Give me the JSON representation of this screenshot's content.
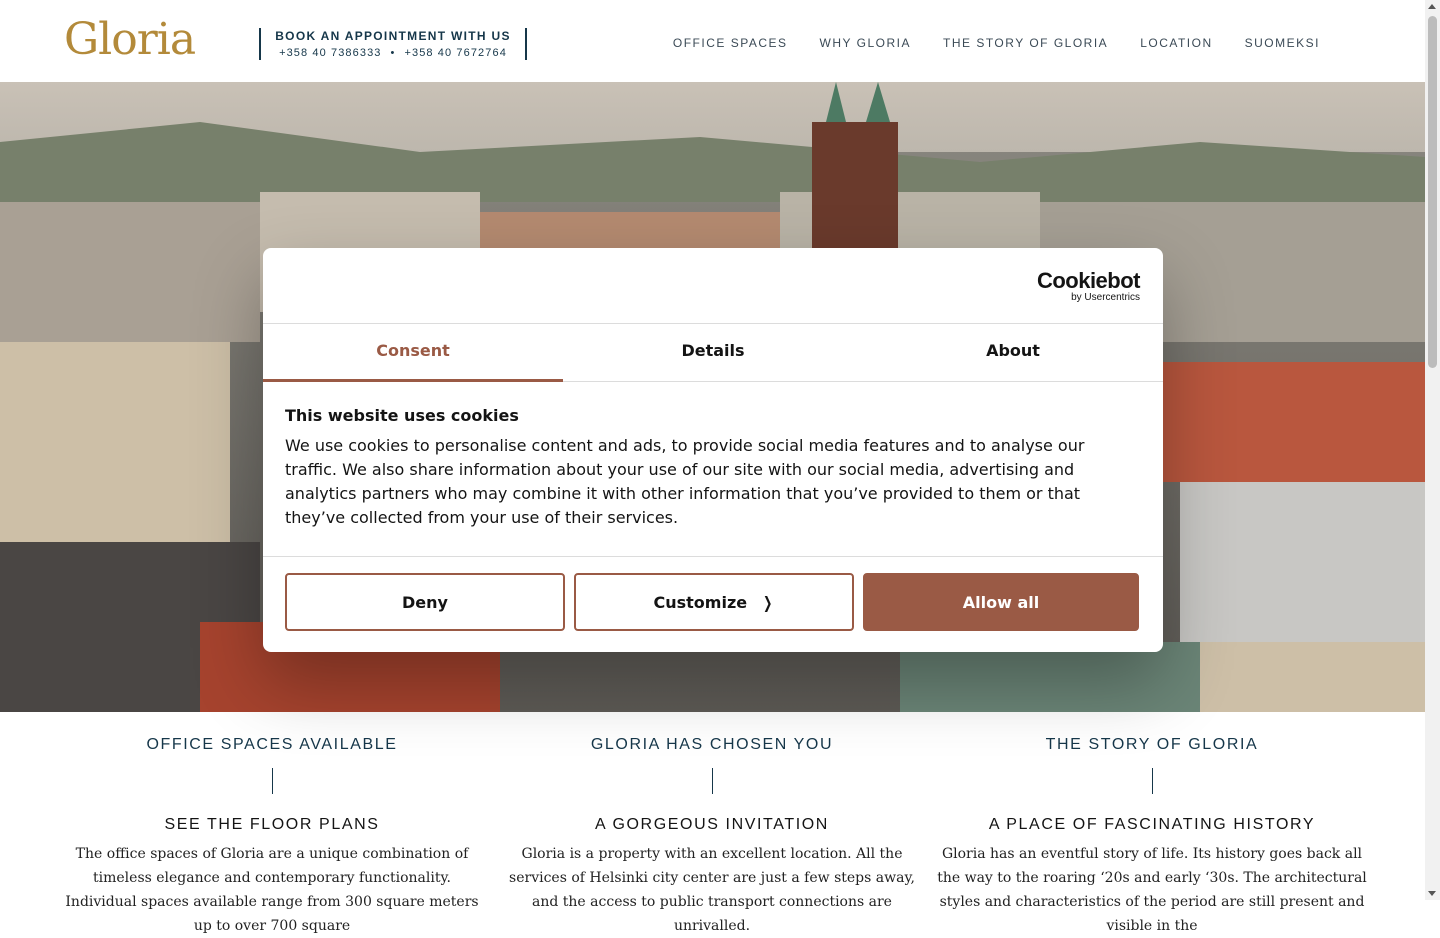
{
  "header": {
    "logo": "Gloria",
    "appointment": {
      "title": "BOOK AN APPOINTMENT WITH US",
      "phone1": "+358 40 7386333",
      "separator": "•",
      "phone2": "+358 40 7672764"
    },
    "nav": [
      "OFFICE SPACES",
      "WHY GLORIA",
      "THE STORY OF GLORIA",
      "LOCATION",
      "SUOMEKSI"
    ]
  },
  "cookie": {
    "brand": "Cookiebot",
    "brand_sub": "by Usercentrics",
    "tabs": [
      "Consent",
      "Details",
      "About"
    ],
    "active_tab": "Consent",
    "heading": "This website uses cookies",
    "text": "We use cookies to personalise content and ads, to provide social media features and to analyse our traffic. We also share information about your use of our site with our social media, advertising and analytics partners who may combine it with other information that you’ve provided to them or that they’ve collected from your use of their services.",
    "deny_label": "Deny",
    "customize_label": "Customize",
    "allow_label": "Allow all",
    "accent_color": "#9a5a45"
  },
  "sections": [
    {
      "title": "OFFICE SPACES AVAILABLE",
      "subtitle": "SEE THE FLOOR PLANS",
      "text": "The office spaces of Gloria are a unique combination of timeless elegance and contemporary functionality. Individual spaces available range from 300 square meters up to over 700 square"
    },
    {
      "title": "GLORIA HAS CHOSEN YOU",
      "subtitle": "A GORGEOUS INVITATION",
      "text": "Gloria is a property with an excellent location. All the services of Helsinki city center are just a few steps away, and the access to public transport connections are unrivalled."
    },
    {
      "title": "THE STORY OF GLORIA",
      "subtitle": "A PLACE OF FASCINATING HISTORY",
      "text": "Gloria has an eventful story of life. Its history goes back all the way to the roaring ‘20s and early ‘30s. The architectural styles and characteristics of the period are still present and visible in the"
    }
  ],
  "colors": {
    "navy": "#16374a",
    "gold": "#b38a3a",
    "accent": "#9a5a45"
  }
}
